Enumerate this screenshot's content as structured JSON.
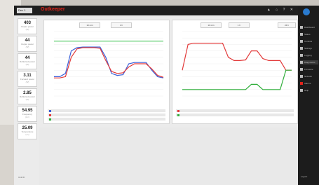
{
  "app": {
    "brand": "Outkeeper",
    "device_select": "Dev 1",
    "top_icons": "▲ ⌂ ? ✕"
  },
  "metrics": [
    {
      "value": "403",
      "label": "Output power",
      "unit": "(W)"
    },
    {
      "value": "44",
      "label": "Output power",
      "unit": "(W)"
    },
    {
      "value": "44",
      "label": "Reflected power",
      "unit": "(W)"
    },
    {
      "value": "3.11",
      "label": "Forward power",
      "unit": "(W)"
    },
    {
      "value": "2.85",
      "label": "Reflected power",
      "unit": "(W)"
    },
    {
      "value": "54.95",
      "label": "Frequency",
      "unit": "(Hz)"
    },
    {
      "value": "25.09",
      "label": "Temperature",
      "unit": "(°C)"
    }
  ],
  "left_bottom": "Unit ID",
  "charts": {
    "left": {
      "toolbar": [
        "10 min",
        "1 h"
      ],
      "rows": [
        {
          "color": "#3a5fd8"
        },
        {
          "color": "#e23a3a"
        },
        {
          "color": "#2fae3a"
        }
      ]
    },
    "right": {
      "toolbar": [
        "10 min",
        "1 h",
        "24 h"
      ],
      "rows": [
        {
          "color": "#e23a3a"
        },
        {
          "color": "#2fae3a"
        }
      ]
    }
  },
  "chart_data": [
    {
      "type": "line",
      "series": [
        {
          "values": [
            30,
            30,
            35,
            70,
            75,
            76,
            76,
            76,
            76,
            60,
            35,
            32,
            33,
            50,
            52,
            52,
            52,
            40,
            30,
            28
          ]
        },
        {
          "values": [
            28,
            28,
            30,
            60,
            73,
            75,
            75,
            75,
            74,
            55,
            38,
            35,
            36,
            45,
            50,
            50,
            50,
            42,
            32,
            29
          ]
        }
      ],
      "reference_line": 85,
      "ylim": [
        0,
        100
      ]
    },
    {
      "type": "line",
      "series": [
        {
          "values": [
            40,
            80,
            82,
            82,
            82,
            82,
            82,
            82,
            60,
            55,
            55,
            56,
            70,
            70,
            58,
            55,
            55,
            55,
            40,
            40
          ]
        },
        {
          "values": [
            10,
            10,
            10,
            10,
            10,
            10,
            10,
            10,
            10,
            10,
            10,
            10,
            18,
            18,
            10,
            10,
            10,
            10,
            40,
            40
          ]
        }
      ],
      "ylim": [
        0,
        100
      ]
    }
  ],
  "sidebar": {
    "items": [
      "Dashboard",
      "Status",
      "Controls",
      "Settings",
      "Logging",
      "Diagnostics",
      "Firmware",
      "Network",
      "Alarms",
      "Help"
    ],
    "footer": "Logout"
  }
}
